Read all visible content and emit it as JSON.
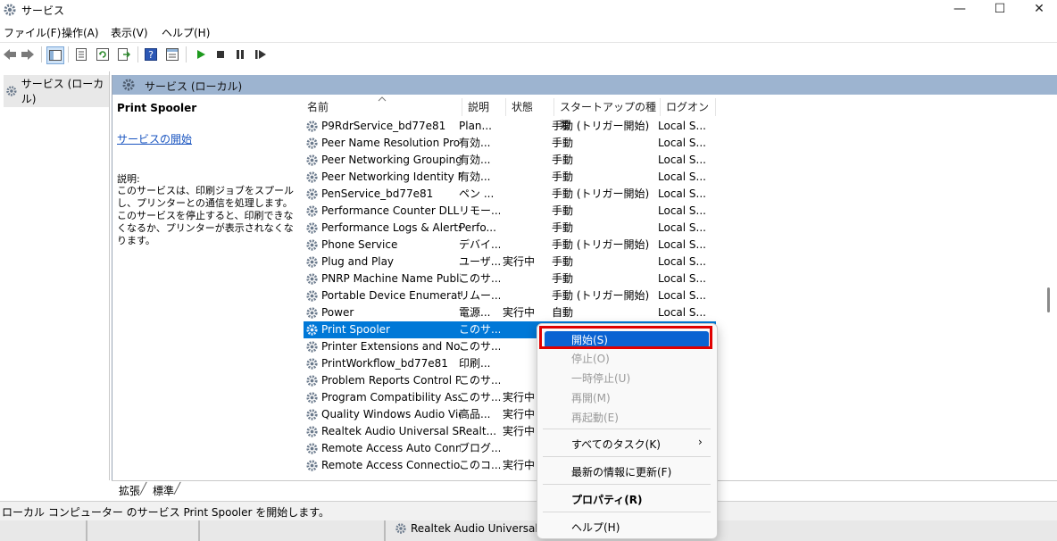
{
  "window": {
    "title": "サービス"
  },
  "menubar": [
    "ファイル(F)",
    "操作(A)",
    "表示(V)",
    "ヘルプ(H)"
  ],
  "tree": {
    "root": "サービス (ローカル)"
  },
  "main": {
    "header": "サービス (ローカル)"
  },
  "details": {
    "service_name": "Print Spooler",
    "start_link": "サービスの開始",
    "desc_label": "説明:",
    "desc_text": "このサービスは、印刷ジョブをスプールし、プリンターとの通信を処理します。このサービスを停止すると、印刷できなくなるか、プリンターが表示されなくなります。"
  },
  "columns": {
    "name": "名前",
    "desc": "説明",
    "status": "状態",
    "startup": "スタートアップの種類",
    "logon": "ログオン"
  },
  "services": [
    {
      "name": "P9RdrService_bd77e81",
      "desc": "Plan...",
      "status": "",
      "startup": "手動 (トリガー開始)",
      "logon": "Local S..."
    },
    {
      "name": "Peer Name Resolution Prot...",
      "desc": "有効...",
      "status": "",
      "startup": "手動",
      "logon": "Local S..."
    },
    {
      "name": "Peer Networking Grouping",
      "desc": "有効...",
      "status": "",
      "startup": "手動",
      "logon": "Local S..."
    },
    {
      "name": "Peer Networking Identity M...",
      "desc": "有効...",
      "status": "",
      "startup": "手動",
      "logon": "Local S..."
    },
    {
      "name": "PenService_bd77e81",
      "desc": "ペン ...",
      "status": "",
      "startup": "手動 (トリガー開始)",
      "logon": "Local S..."
    },
    {
      "name": "Performance Counter DLL H...",
      "desc": "リモー...",
      "status": "",
      "startup": "手動",
      "logon": "Local S..."
    },
    {
      "name": "Performance Logs & Alerts",
      "desc": "Perfo...",
      "status": "",
      "startup": "手動",
      "logon": "Local S..."
    },
    {
      "name": "Phone Service",
      "desc": "デバイ...",
      "status": "",
      "startup": "手動 (トリガー開始)",
      "logon": "Local S..."
    },
    {
      "name": "Plug and Play",
      "desc": "ユーザ...",
      "status": "実行中",
      "startup": "手動",
      "logon": "Local S..."
    },
    {
      "name": "PNRP Machine Name Publi...",
      "desc": "このサ...",
      "status": "",
      "startup": "手動",
      "logon": "Local S..."
    },
    {
      "name": "Portable Device Enumerator...",
      "desc": "リムー...",
      "status": "",
      "startup": "手動 (トリガー開始)",
      "logon": "Local S..."
    },
    {
      "name": "Power",
      "desc": "電源...",
      "status": "実行中",
      "startup": "自動",
      "logon": "Local S..."
    },
    {
      "name": "Print Spooler",
      "desc": "このサ...",
      "status": "",
      "startup": "",
      "logon": ""
    },
    {
      "name": "Printer Extensions and Notif...",
      "desc": "このサ...",
      "status": "",
      "startup": "",
      "logon": ""
    },
    {
      "name": "PrintWorkflow_bd77e81",
      "desc": "印刷...",
      "status": "",
      "startup": "",
      "logon": ""
    },
    {
      "name": "Problem Reports Control Pa...",
      "desc": "このサ...",
      "status": "",
      "startup": "",
      "logon": ""
    },
    {
      "name": "Program Compatibility Assis...",
      "desc": "このサ...",
      "status": "実行中",
      "startup": "",
      "logon": ""
    },
    {
      "name": "Quality Windows Audio Vid...",
      "desc": "高品...",
      "status": "実行中",
      "startup": "",
      "logon": ""
    },
    {
      "name": "Realtek Audio Universal Ser...",
      "desc": "Realt...",
      "status": "実行中",
      "startup": "",
      "logon": ""
    },
    {
      "name": "Remote Access Auto Conne...",
      "desc": "ブログ...",
      "status": "",
      "startup": "",
      "logon": ""
    },
    {
      "name": "Remote Access Connection ...",
      "desc": "このコ...",
      "status": "実行中",
      "startup": "",
      "logon": ""
    }
  ],
  "tabs": [
    "拡張",
    "標準"
  ],
  "statusbar": "ローカル コンピューター のサービス Print Spooler を開始します。",
  "background_window": {
    "fragment": "Realtek Audio Universal Ser"
  },
  "context_menu": {
    "start": "開始(S)",
    "stop": "停止(O)",
    "pause": "一時停止(U)",
    "resume": "再開(M)",
    "restart": "再起動(E)",
    "all_tasks": "すべてのタスク(K)",
    "refresh": "最新の情報に更新(F)",
    "properties": "プロパティ(R)",
    "help": "ヘルプ(H)"
  },
  "colors": {
    "selection": "#0078d7",
    "highlight_box": "#e00000",
    "pane_header": "#9db4d0"
  }
}
